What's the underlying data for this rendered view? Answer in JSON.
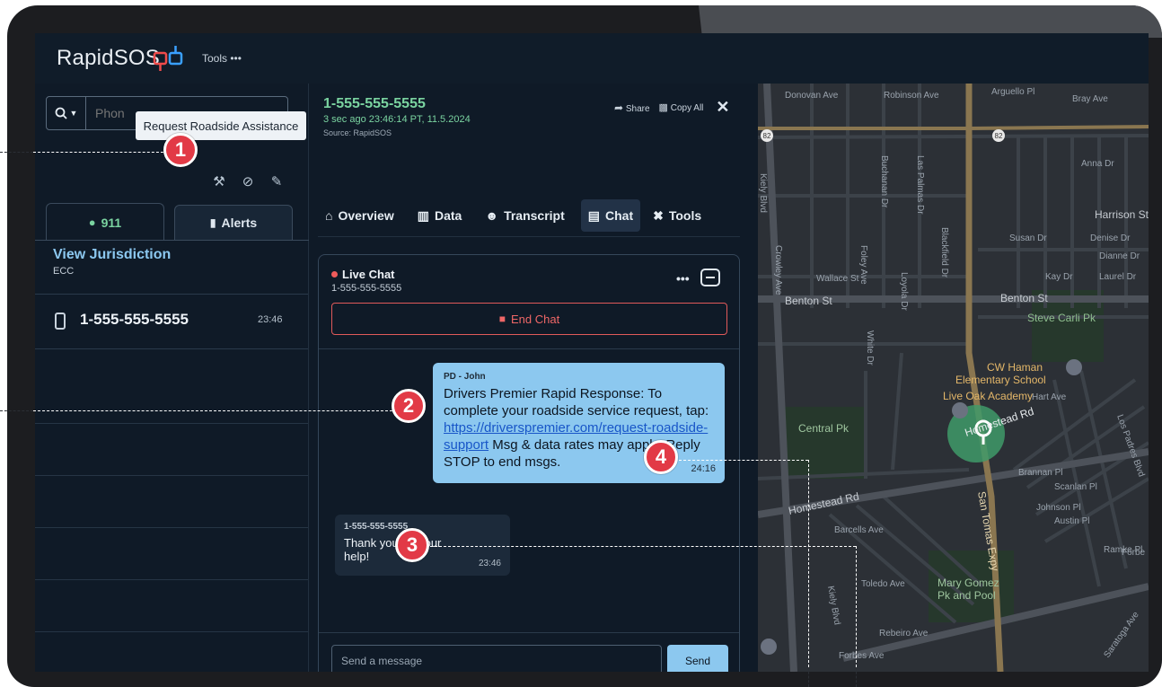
{
  "app": {
    "brand": "RapidSOS",
    "tools_menu": "Tools •••"
  },
  "sidebar": {
    "search_placeholder": "Phon",
    "tooltip": "Request Roadside Assistance",
    "tabs": [
      {
        "label": "911",
        "icon": "location-pin-icon"
      },
      {
        "label": "Alerts",
        "icon": "bookmark-icon"
      }
    ],
    "jurisdiction": {
      "title": "View Jurisdiction",
      "subtitle": "ECC"
    },
    "calls": [
      {
        "number": "1-555-555-5555",
        "time": "23:46"
      }
    ]
  },
  "caller": {
    "number": "1-555-555-5555",
    "time": "3 sec ago 23:46:14 PT, 11.5.2024",
    "source": "Source: RapidSOS",
    "share_label": "Share",
    "copy_label": "Copy All"
  },
  "nav_tabs": [
    {
      "label": "Overview",
      "icon": "home-icon"
    },
    {
      "label": "Data",
      "icon": "database-icon"
    },
    {
      "label": "Transcript",
      "icon": "transcript-icon"
    },
    {
      "label": "Chat",
      "icon": "chat-icon",
      "active": true
    },
    {
      "label": "Tools",
      "icon": "tools-icon"
    }
  ],
  "chat": {
    "title": "Live Chat",
    "subtitle": "1-555-555-5555",
    "end_label": "End Chat",
    "messages": [
      {
        "sender": "PD - John",
        "text_before": "Drivers Premier Rapid Response: To complete your roadside service request, tap: ",
        "link": "https://driverspremier.com/request-roadside-support",
        "text_after": " Msg & data rates may apply. Reply STOP to end msgs.",
        "time": "24:16"
      },
      {
        "sender": "1-555-555-5555",
        "text": "Thank you for your help!",
        "time": "23:46"
      }
    ],
    "input_placeholder": "Send a message",
    "send_label": "Send"
  },
  "map": {
    "labels": {
      "arguello": "Arguello Pl",
      "bray": "Bray Ave",
      "donovan": "Donovan Ave",
      "robinson": "Robinson Ave",
      "anna": "Anna Dr",
      "harrison": "Harrison St",
      "susan": "Susan Dr",
      "denise": "Denise Dr",
      "dianne": "Dianne Dr",
      "kay": "Kay Dr",
      "laurel": "Laurel Dr",
      "benton_left": "Benton St",
      "benton_right": "Benton St",
      "wallace": "Wallace St",
      "steve_carli": "Steve Carli Pk",
      "cw_haman_1": "CW Haman",
      "cw_haman_2": "Elementary School",
      "live_oak": "Live Oak Academy",
      "central_pk": "Central Pk",
      "homestead_left": "Homestead Rd",
      "homestead_right": "Homestead Rd",
      "hart": "Hart Ave",
      "brannan": "Brannan Pl",
      "scanlan": "Scanlan Pl",
      "johnson": "Johnson Pl",
      "austin": "Austin Pl",
      "ramke": "Ramke Pl",
      "san_tomas": "San Tomas Expy",
      "mary_gomez_1": "Mary Gomez",
      "mary_gomez_2": "Pk and Pool",
      "barcells": "Barcells Ave",
      "toledo": "Toledo Ave",
      "rebeiro": "Rebeiro Ave",
      "forbes": "Forbes Ave",
      "forbe": "Forbe",
      "kiely": "Kiely Blvd",
      "kiely_2": "Kiely Blvd",
      "crowley": "Crowley Ave",
      "foley": "Foley Ave",
      "loyola": "Loyola Dr",
      "buchanan": "Buchanan Dr",
      "las_palmas": "Las Palmas Dr",
      "blackfield": "Blackfield Dr",
      "white": "White Dr",
      "los_padres": "Los Padres Blvd",
      "hwy_82_a": "82",
      "hwy_82_b": "82",
      "saratoga": "Saratoga Ave"
    }
  },
  "callouts": [
    "1",
    "2",
    "3",
    "4"
  ],
  "colors": {
    "accent_blue": "#8cc8ef",
    "accent_green": "#7ad3a0",
    "danger_red": "#e23a46",
    "panel_bg": "#0f1a27"
  }
}
